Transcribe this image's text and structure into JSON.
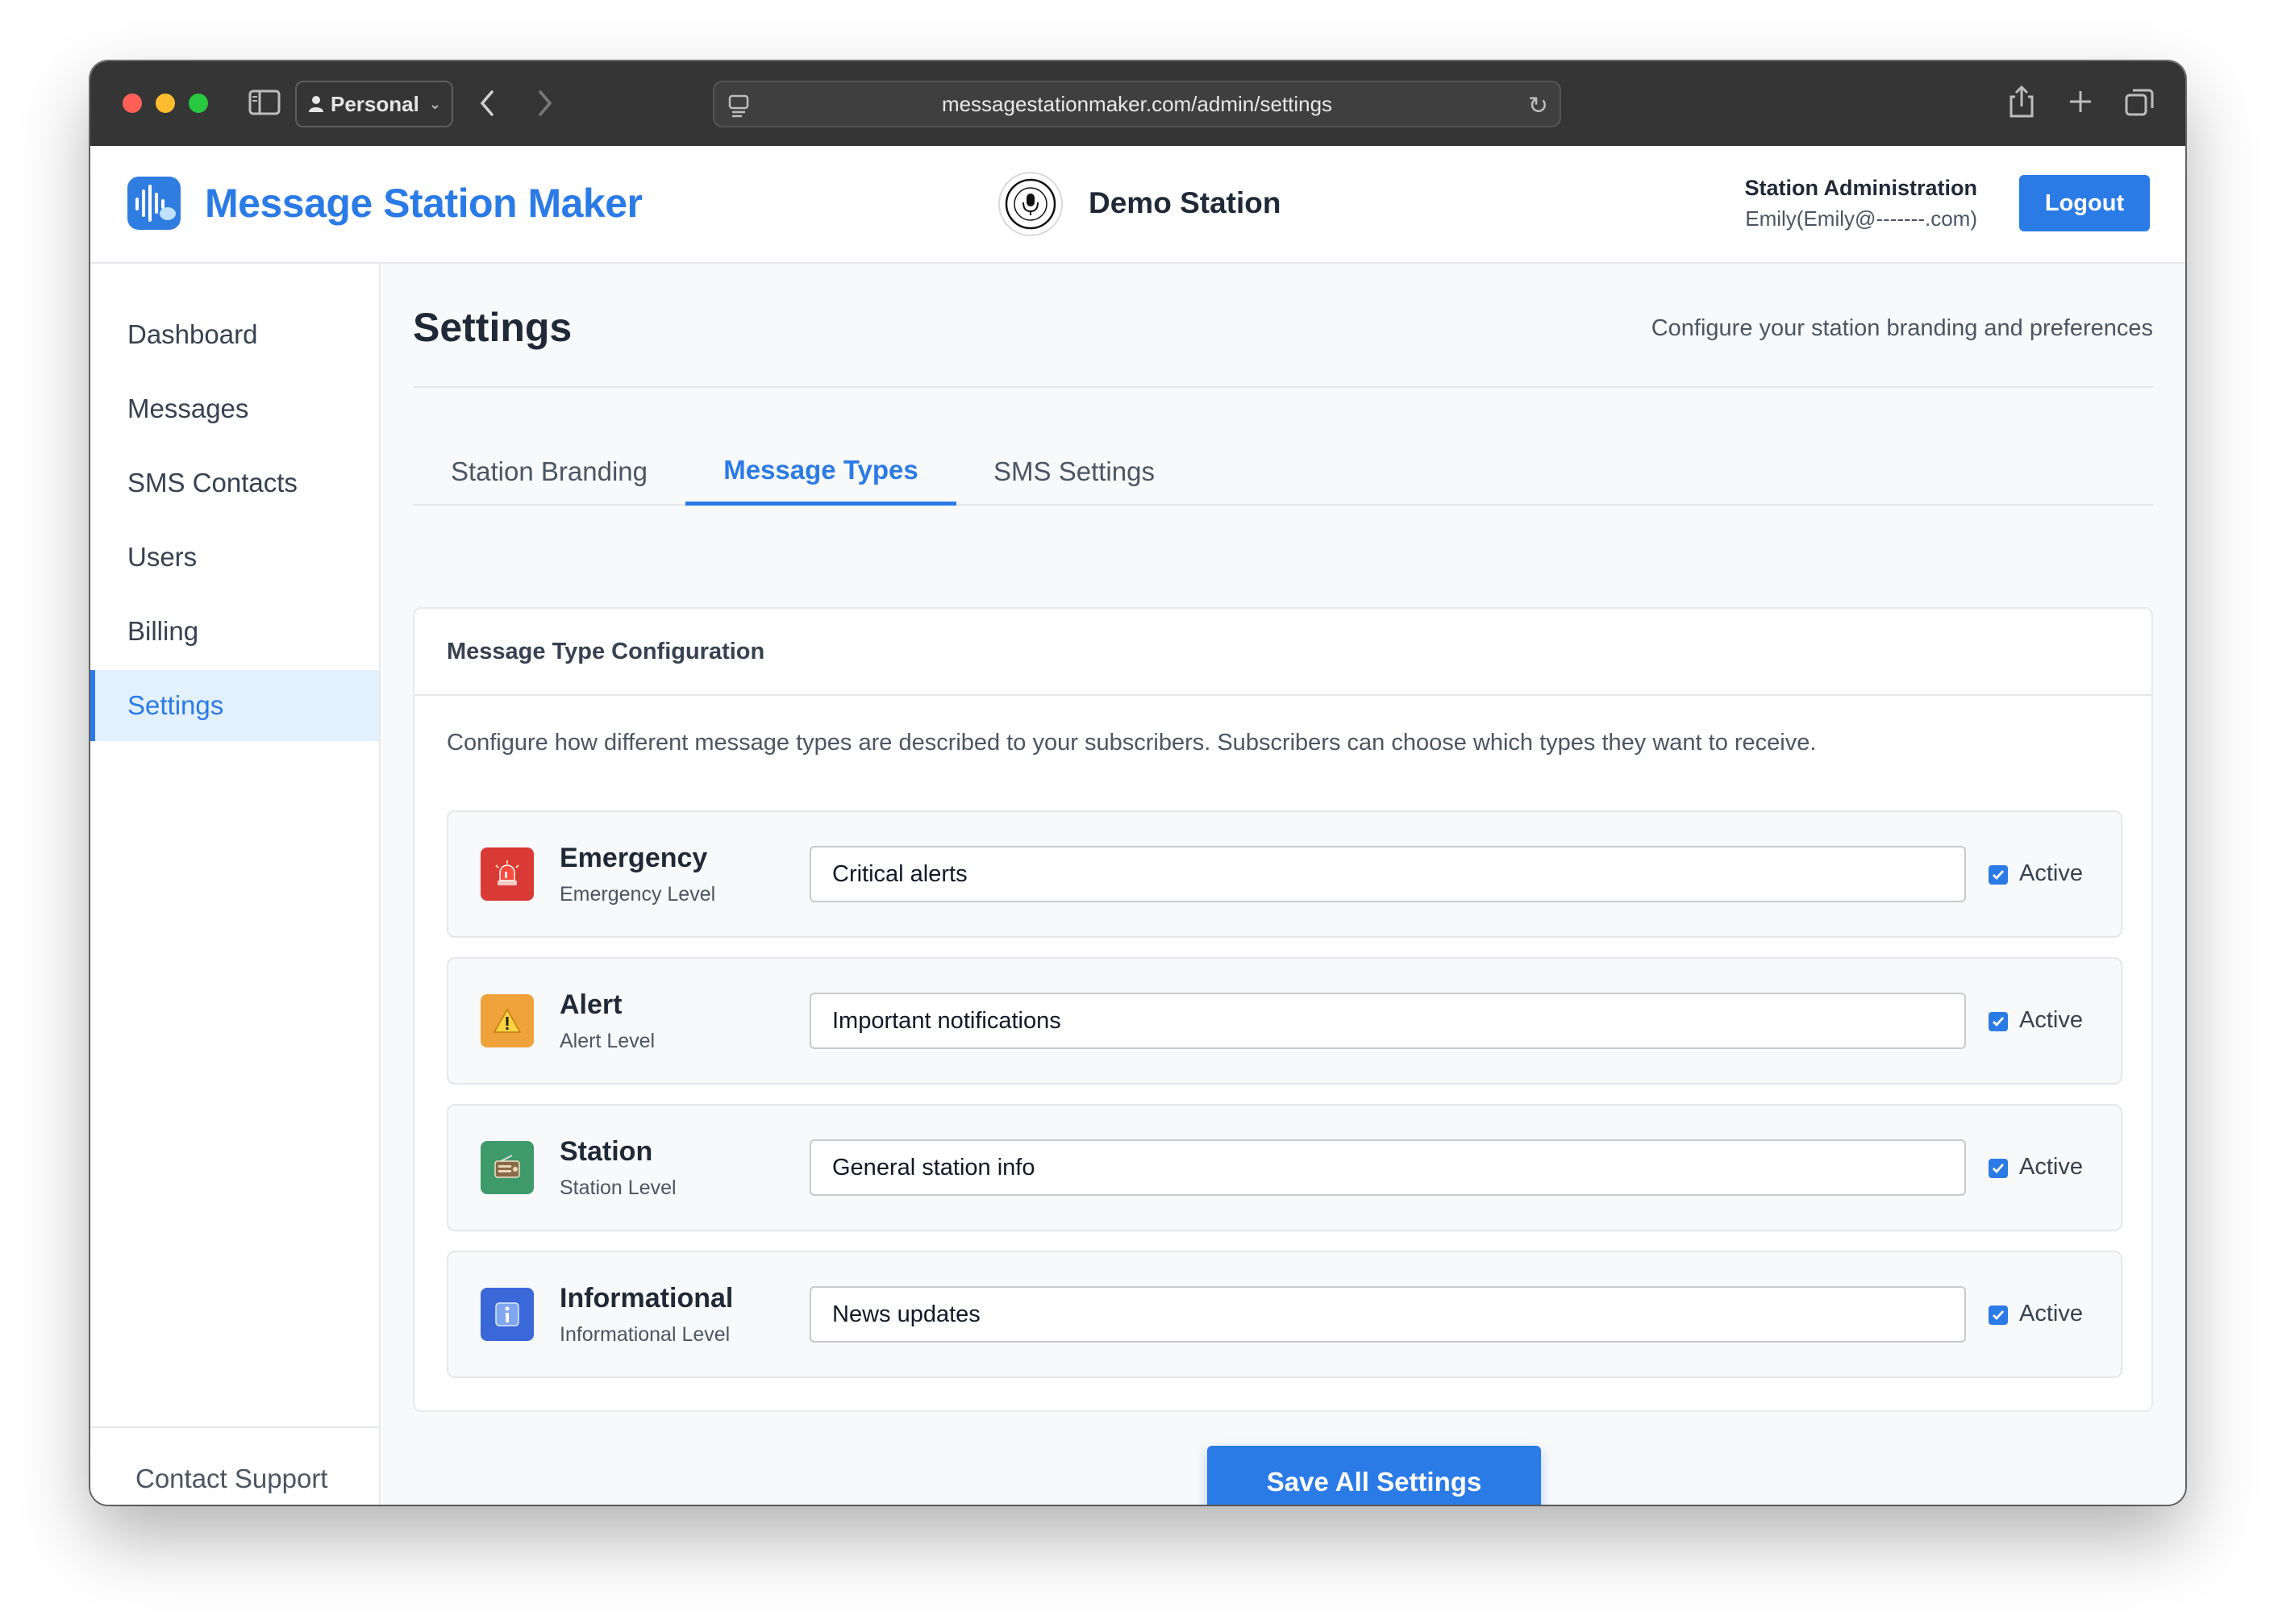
{
  "browser": {
    "profile_label": "Personal",
    "url": "messagestationmaker.com/admin/settings"
  },
  "header": {
    "brand_title": "Message Station Maker",
    "station_name": "Demo Station",
    "admin_title": "Station Administration",
    "admin_email": "Emily(Emily@-------.com)",
    "logout_label": "Logout"
  },
  "sidebar": {
    "items": [
      {
        "label": "Dashboard"
      },
      {
        "label": "Messages"
      },
      {
        "label": "SMS Contacts"
      },
      {
        "label": "Users"
      },
      {
        "label": "Billing"
      },
      {
        "label": "Settings",
        "active": true
      }
    ],
    "support_label": "Contact Support"
  },
  "main": {
    "title": "Settings",
    "subtitle": "Configure your station branding and preferences",
    "tabs": [
      {
        "label": "Station Branding"
      },
      {
        "label": "Message Types",
        "active": true
      },
      {
        "label": "SMS Settings"
      }
    ],
    "card": {
      "title": "Message Type Configuration",
      "description": "Configure how different message types are described to your subscribers. Subscribers can choose which types they want to receive.",
      "types": [
        {
          "name": "Emergency",
          "level": "Emergency Level",
          "description": "Critical alerts",
          "active": true,
          "active_label": "Active",
          "icon": "siren-icon",
          "color": "#d93a35"
        },
        {
          "name": "Alert",
          "level": "Alert Level",
          "description": "Important notifications",
          "active": true,
          "active_label": "Active",
          "icon": "warning-icon",
          "color": "#f0a23a"
        },
        {
          "name": "Station",
          "level": "Station Level",
          "description": "General station info",
          "active": true,
          "active_label": "Active",
          "icon": "radio-icon",
          "color": "#3f9a6b"
        },
        {
          "name": "Informational",
          "level": "Informational Level",
          "description": "News updates",
          "active": true,
          "active_label": "Active",
          "icon": "info-icon",
          "color": "#3a68d8"
        }
      ]
    },
    "save_label": "Save All Settings"
  },
  "colors": {
    "accent": "#2b7be6",
    "sidebar_active_bg": "#e3f0fd",
    "chrome": "#353535"
  }
}
